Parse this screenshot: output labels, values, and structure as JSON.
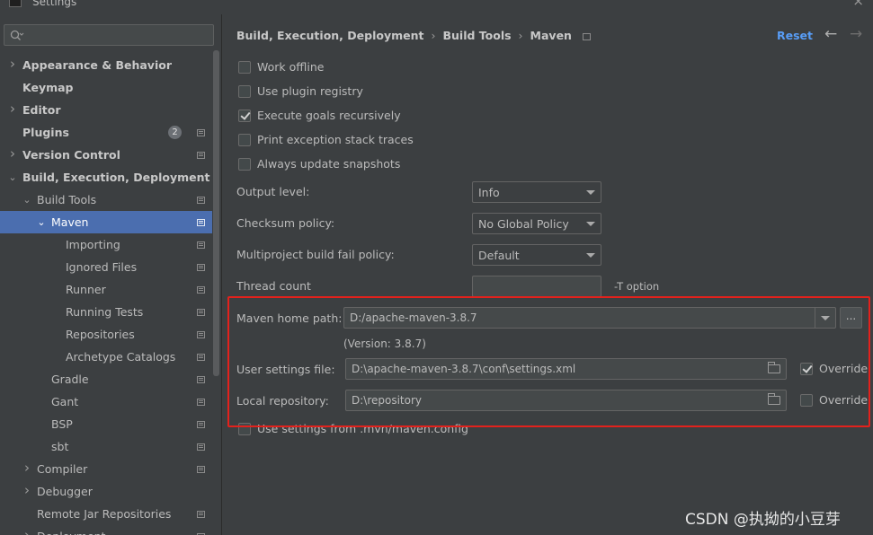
{
  "window": {
    "title": "Settings",
    "close_glyph": "×"
  },
  "search": {
    "placeholder": "",
    "icon": "search-icon"
  },
  "sidebar": {
    "items": [
      {
        "label": "Appearance & Behavior",
        "arrow": "›",
        "level": 0,
        "bold": true
      },
      {
        "label": "Keymap",
        "arrow": "",
        "level": 0,
        "bold": true
      },
      {
        "label": "Editor",
        "arrow": "›",
        "level": 0,
        "bold": true
      },
      {
        "label": "Plugins",
        "arrow": "",
        "level": 0,
        "bold": true,
        "badge": "2",
        "proj": true
      },
      {
        "label": "Version Control",
        "arrow": "›",
        "level": 0,
        "bold": true,
        "proj": true
      },
      {
        "label": "Build, Execution, Deployment",
        "arrow": "⌄",
        "level": 0,
        "bold": true
      },
      {
        "label": "Build Tools",
        "arrow": "⌄",
        "level": 1,
        "proj": true
      },
      {
        "label": "Maven",
        "arrow": "⌄",
        "level": 2,
        "proj": true,
        "selected": true
      },
      {
        "label": "Importing",
        "arrow": "",
        "level": 3,
        "proj": true
      },
      {
        "label": "Ignored Files",
        "arrow": "",
        "level": 3,
        "proj": true
      },
      {
        "label": "Runner",
        "arrow": "",
        "level": 3,
        "proj": true
      },
      {
        "label": "Running Tests",
        "arrow": "",
        "level": 3,
        "proj": true
      },
      {
        "label": "Repositories",
        "arrow": "",
        "level": 3,
        "proj": true
      },
      {
        "label": "Archetype Catalogs",
        "arrow": "",
        "level": 3,
        "proj": true
      },
      {
        "label": "Gradle",
        "arrow": "",
        "level": 2,
        "proj": true
      },
      {
        "label": "Gant",
        "arrow": "",
        "level": 2,
        "proj": true
      },
      {
        "label": "BSP",
        "arrow": "",
        "level": 2,
        "proj": true
      },
      {
        "label": "sbt",
        "arrow": "",
        "level": 2,
        "proj": true
      },
      {
        "label": "Compiler",
        "arrow": "›",
        "level": 1,
        "proj": true
      },
      {
        "label": "Debugger",
        "arrow": "›",
        "level": 1
      },
      {
        "label": "Remote Jar Repositories",
        "arrow": "",
        "level": 1,
        "proj": true
      },
      {
        "label": "Deployment",
        "arrow": "›",
        "level": 1,
        "proj": true
      }
    ]
  },
  "breadcrumb": {
    "parts": [
      "Build, Execution, Deployment",
      "Build Tools",
      "Maven"
    ],
    "separator": "›"
  },
  "header": {
    "reset_label": "Reset",
    "back_glyph": "←",
    "forward_glyph": "→"
  },
  "options": {
    "checkboxes": [
      {
        "label": "Work offline",
        "checked": false
      },
      {
        "label": "Use plugin registry",
        "checked": false
      },
      {
        "label": "Execute goals recursively",
        "checked": true
      },
      {
        "label": "Print exception stack traces",
        "checked": false
      },
      {
        "label": "Always update snapshots",
        "checked": false
      }
    ],
    "output_level": {
      "label": "Output level:",
      "value": "Info"
    },
    "checksum_policy": {
      "label": "Checksum policy:",
      "value": "No Global Policy"
    },
    "multiproject_fail_policy": {
      "label": "Multiproject build fail policy:",
      "value": "Default"
    },
    "thread_count": {
      "label": "Thread count",
      "value": "",
      "hint": "-T option"
    },
    "maven_home": {
      "label": "Maven home path:",
      "value": "D:/apache-maven-3.8.7",
      "version": "(Version: 3.8.7)",
      "browse_label": "..."
    },
    "user_settings": {
      "label": "User settings file:",
      "value": "D:\\apache-maven-3.8.7\\conf\\settings.xml",
      "override_label": "Override",
      "override_checked": true
    },
    "local_repository": {
      "label": "Local repository:",
      "value": "D:\\repository",
      "override_label": "Override",
      "override_checked": false
    },
    "use_mvn_config": {
      "label": "Use settings from .mvn/maven.config",
      "checked": false
    }
  },
  "watermark": "CSDN @执拗的小豆芽",
  "colors": {
    "background": "#3c3f41",
    "selection": "#4b6eaf",
    "link": "#589df6",
    "highlight_box": "#e3211c"
  }
}
